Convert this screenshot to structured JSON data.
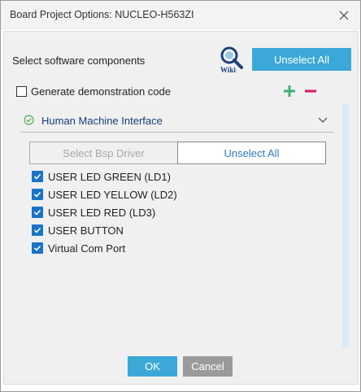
{
  "window": {
    "title": "Board Project Options: NUCLEO-H563ZI"
  },
  "header": {
    "section_title": "Select software components",
    "wiki_label": "Wiki",
    "unselect_all_label": "Unselect All"
  },
  "demo": {
    "label": "Generate demonstration code",
    "checked": false
  },
  "group": {
    "label": "Human Machine Interface",
    "status": "checked",
    "expanded": true
  },
  "bsp": {
    "select_label": "Select Bsp Driver",
    "unselect_label": "Unselect All"
  },
  "drivers": [
    {
      "label": "USER LED GREEN (LD1)",
      "checked": true
    },
    {
      "label": "USER LED YELLOW (LD2)",
      "checked": true
    },
    {
      "label": "USER LED RED (LD3)",
      "checked": true
    },
    {
      "label": "USER BUTTON",
      "checked": true
    },
    {
      "label": "Virtual Com Port",
      "checked": true
    }
  ],
  "footer": {
    "ok_label": "OK",
    "cancel_label": "Cancel"
  },
  "colors": {
    "accent": "#3ca8d8",
    "checkbox": "#1a73c8",
    "plus": "#3cb371",
    "minus": "#e0156b",
    "group_text": "#1a3c78",
    "success": "#4caf50"
  },
  "icons": {
    "close": "close-icon",
    "wiki": "wiki-search-icon",
    "add": "plus-icon",
    "remove": "minus-icon",
    "status": "check-circle-icon",
    "expand": "chevron-down-icon"
  }
}
